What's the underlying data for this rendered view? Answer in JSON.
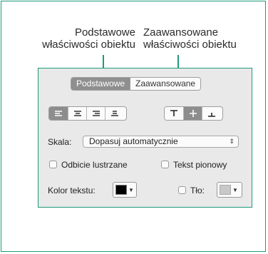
{
  "callouts": {
    "basic": [
      "Podstawowe",
      "właściwości obiektu"
    ],
    "advanced": [
      "Zaawansowane",
      "właściwości obiektu"
    ]
  },
  "tabs": {
    "basic": "Podstawowe",
    "advanced": "Zaawansowane"
  },
  "alignment": {
    "horizontal": [
      "align-left-icon",
      "align-center-icon",
      "align-right-icon",
      "align-justify-icon"
    ],
    "horizontal_selected": "align-left-icon",
    "vertical": [
      "align-top-icon",
      "align-middle-icon",
      "align-bottom-icon"
    ],
    "vertical_selected": "align-middle-icon"
  },
  "scale": {
    "label": "Skala:",
    "value": "Dopasuj automatycznie"
  },
  "options": {
    "mirror": "Odbicie lustrzane",
    "vertical_text": "Tekst pionowy"
  },
  "colors": {
    "text_color_label": "Kolor tekstu:",
    "background_label": "Tło:",
    "text_color": "#000000",
    "background_color": "#c8c8c8"
  },
  "accent": "#1f9b7a"
}
